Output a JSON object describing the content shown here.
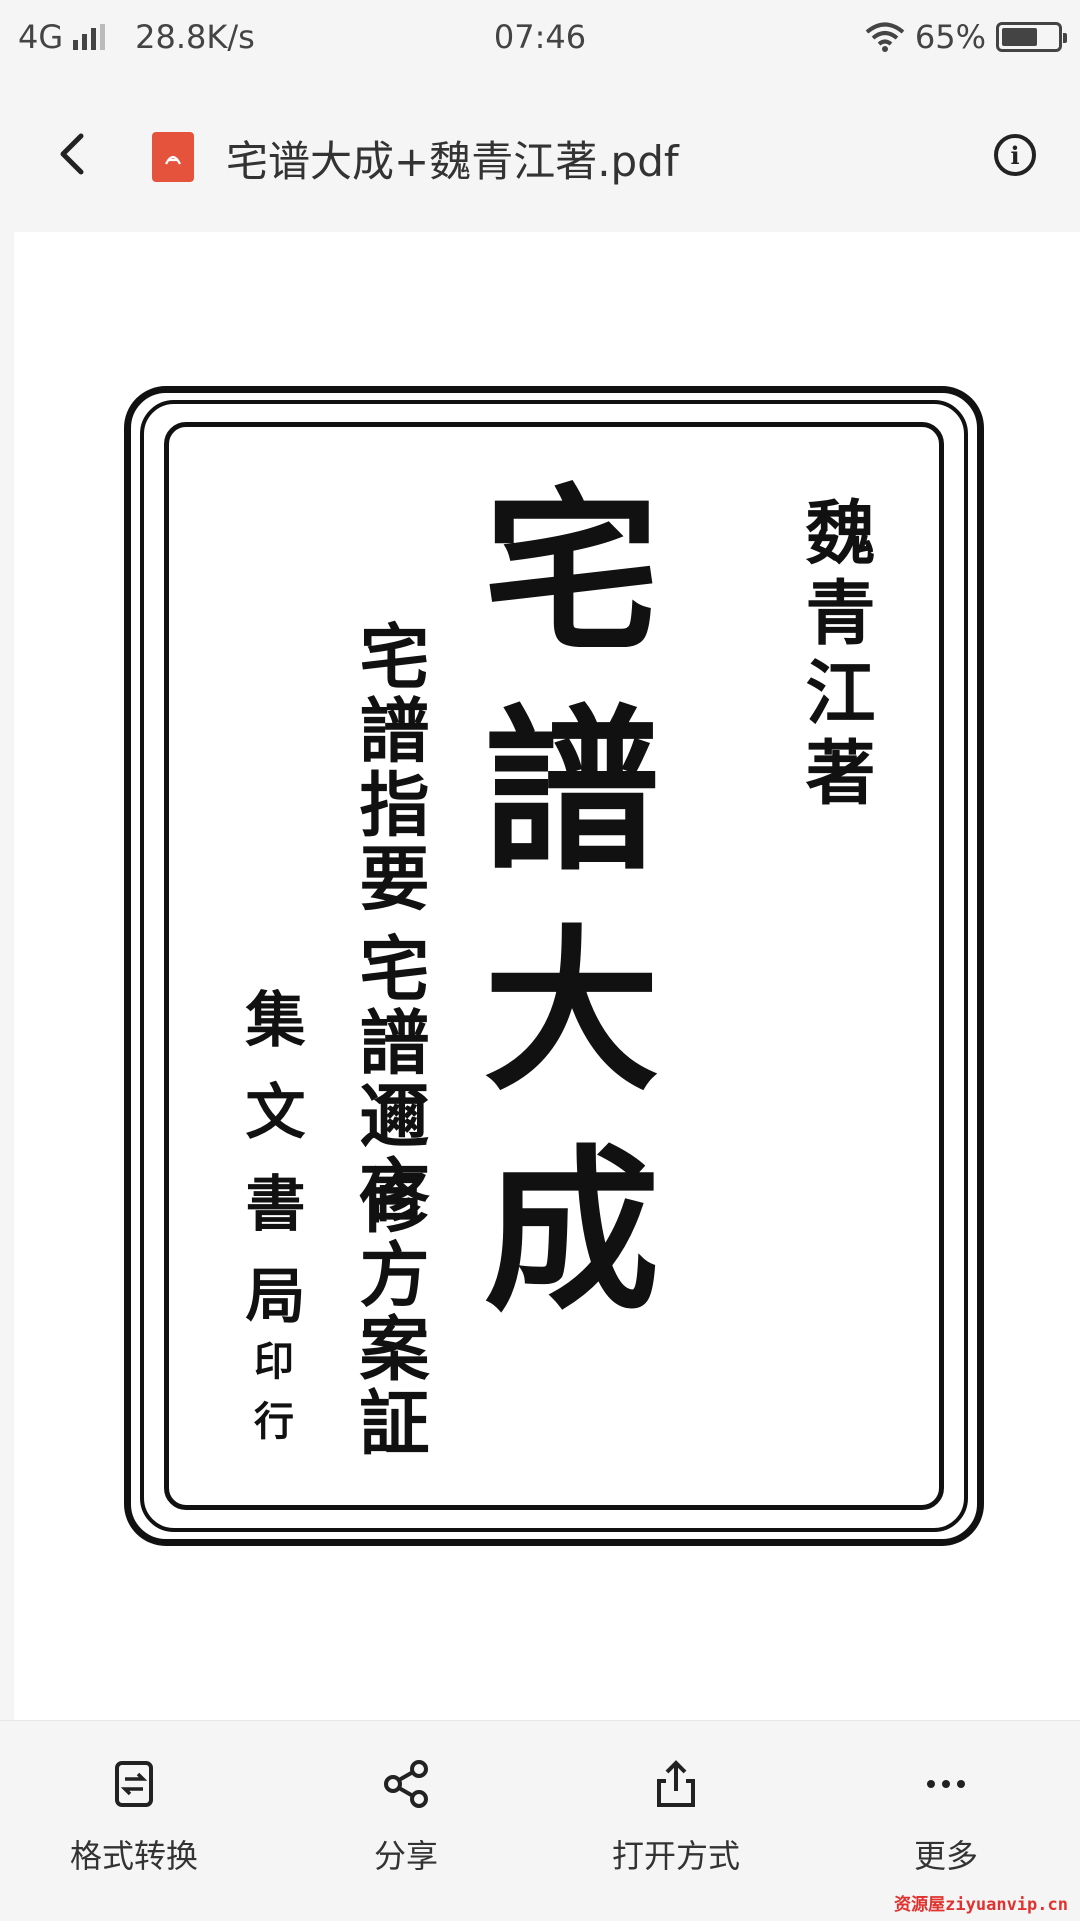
{
  "status_bar": {
    "network": "4G",
    "speed": "28.8K/s",
    "time": "07:46",
    "battery": "65%"
  },
  "header": {
    "file_title": "宅谱大成+魏青江著.pdf",
    "file_type_icon": "pdf-icon",
    "back_icon": "chevron-left-icon",
    "info_icon": "info-icon"
  },
  "document": {
    "main_title": "宅譜大成",
    "author": "魏青江著",
    "subtitle_1": "宅譜指要",
    "subtitle_2": "宅譜邇言",
    "subtitle_3": "修方案証",
    "publisher": "集文書局",
    "printing": "印行"
  },
  "toolbar": {
    "items": [
      {
        "label": "格式转换",
        "icon": "format-convert-icon"
      },
      {
        "label": "分享",
        "icon": "share-icon"
      },
      {
        "label": "打开方式",
        "icon": "open-with-icon"
      },
      {
        "label": "更多",
        "icon": "more-icon"
      }
    ]
  },
  "watermark": "资源屋ziyuanvip.cn",
  "colors": {
    "background": "#f5f5f5",
    "pdf_icon": "#e5533d",
    "watermark": "#e0322f"
  }
}
